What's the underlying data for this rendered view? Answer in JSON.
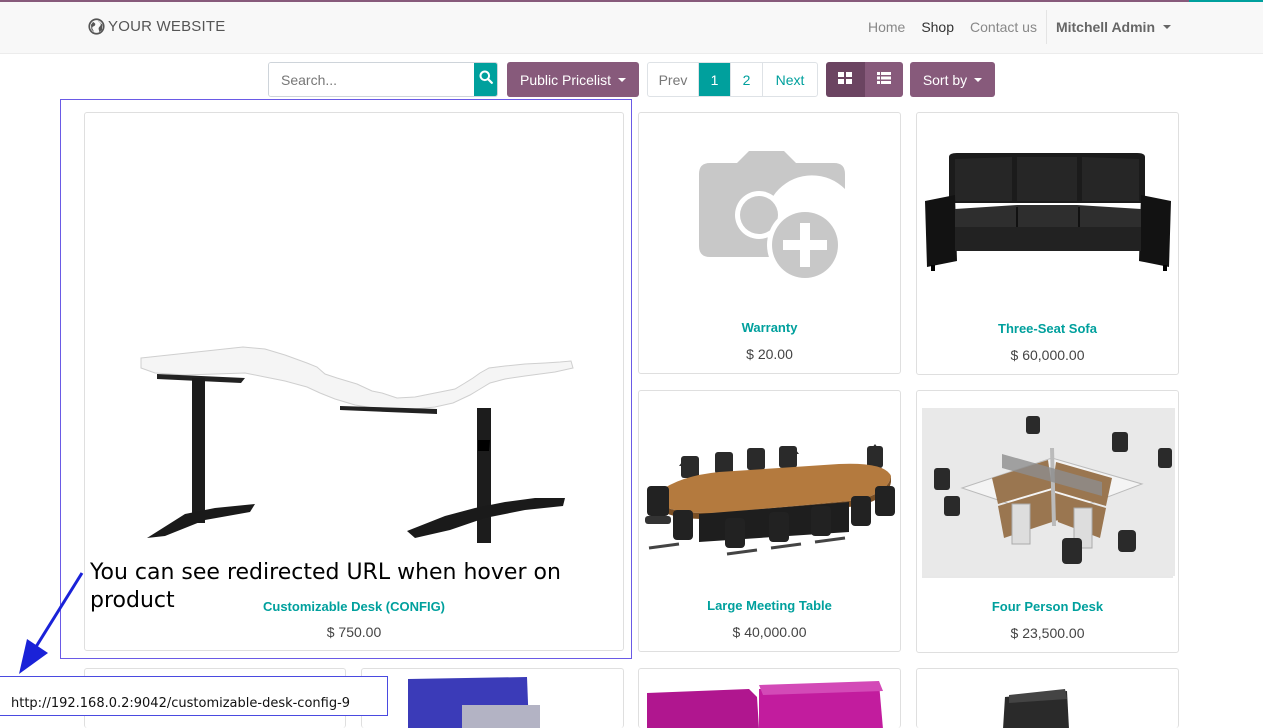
{
  "brand": {
    "name": "YOUR WEBSITE",
    "icon": "globe-icon"
  },
  "nav": {
    "items": [
      {
        "label": "Home",
        "active": false
      },
      {
        "label": "Shop",
        "active": true
      },
      {
        "label": "Contact us",
        "active": false
      }
    ],
    "user": "Mitchell Admin"
  },
  "search": {
    "placeholder": "Search...",
    "value": ""
  },
  "pricelist": {
    "label": "Public Pricelist"
  },
  "pager": {
    "prev": "Prev",
    "pages": [
      "1",
      "2"
    ],
    "current": "1",
    "next": "Next"
  },
  "sort": {
    "label": "Sort by"
  },
  "products": [
    {
      "name": "Customizable Desk (CONFIG)",
      "price": "$ 750.00",
      "image": "corner-desk"
    },
    {
      "name": "Warranty",
      "price": "$ 20.00",
      "image": "camera-placeholder"
    },
    {
      "name": "Three-Seat Sofa",
      "price": "$ 60,000.00",
      "image": "black-sofa"
    },
    {
      "name": "Large Meeting Table",
      "price": "$ 40,000.00",
      "image": "meeting-table"
    },
    {
      "name": "Four Person Desk",
      "price": "$ 23,500.00",
      "image": "office-workstation"
    }
  ],
  "annotation": {
    "text": "You can see redirected URL when hover on product"
  },
  "status_url": "http://192.168.0.2:9042/customizable-desk-config-9",
  "colors": {
    "primary": "#875a7b",
    "accent": "#00a09d",
    "highlight": "#6a5ae6",
    "arrow": "#1a22d8"
  }
}
